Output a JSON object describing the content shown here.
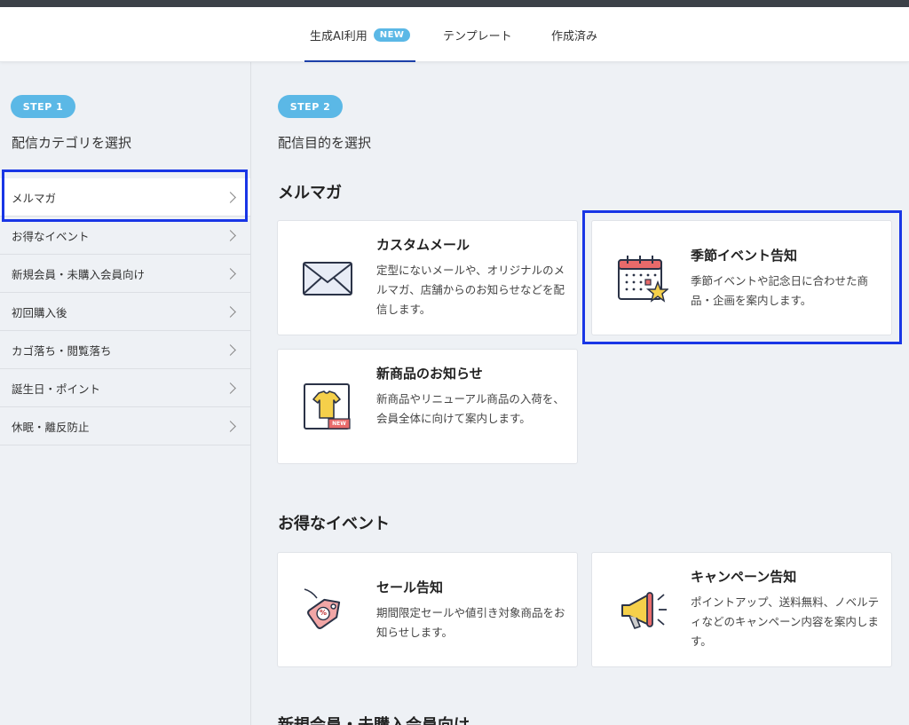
{
  "tabs": [
    {
      "label": "生成AI利用",
      "badge": "NEW",
      "active": true
    },
    {
      "label": "テンプレート",
      "active": false
    },
    {
      "label": "作成済み",
      "active": false
    }
  ],
  "step1": {
    "pill": "STEP 1",
    "title": "配信カテゴリを選択"
  },
  "step2": {
    "pill": "STEP 2",
    "title": "配信目的を選択"
  },
  "categories": [
    {
      "label": "メルマガ",
      "selected": true
    },
    {
      "label": "お得なイベント"
    },
    {
      "label": "新規会員・未購入会員向け"
    },
    {
      "label": "初回購入後"
    },
    {
      "label": "カゴ落ち・閲覧落ち"
    },
    {
      "label": "誕生日・ポイント"
    },
    {
      "label": "休眠・離反防止"
    }
  ],
  "sections": [
    {
      "title": "メルマガ",
      "cards": [
        {
          "title": "カスタムメール",
          "desc": "定型にないメールや、オリジナルのメルマガ、店舗からのお知らせなどを配信します。",
          "icon": "envelope-icon"
        },
        {
          "title": "季節イベント告知",
          "desc": "季節イベントや記念日に合わせた商品・企画を案内します。",
          "icon": "calendar-star-icon"
        },
        {
          "title": "新商品のお知らせ",
          "desc": "新商品やリニューアル商品の入荷を、会員全体に向けて案内します。",
          "icon": "new-tshirt-icon",
          "icon_badge": "NEW"
        }
      ]
    },
    {
      "title": "お得なイベント",
      "cards": [
        {
          "title": "セール告知",
          "desc": "期間限定セールや値引き対象商品をお知らせします。",
          "icon": "sale-tag-icon",
          "icon_text": "%"
        },
        {
          "title": "キャンペーン告知",
          "desc": "ポイントアップ、送料無料、ノベルティなどのキャンペーン内容を案内します。",
          "icon": "megaphone-icon"
        }
      ]
    },
    {
      "title": "新規会員・未購入会員向け"
    }
  ],
  "colors": {
    "accent": "#5bb8e6",
    "highlight": "#1936e6",
    "tab_underline": "#1c3fa8"
  }
}
